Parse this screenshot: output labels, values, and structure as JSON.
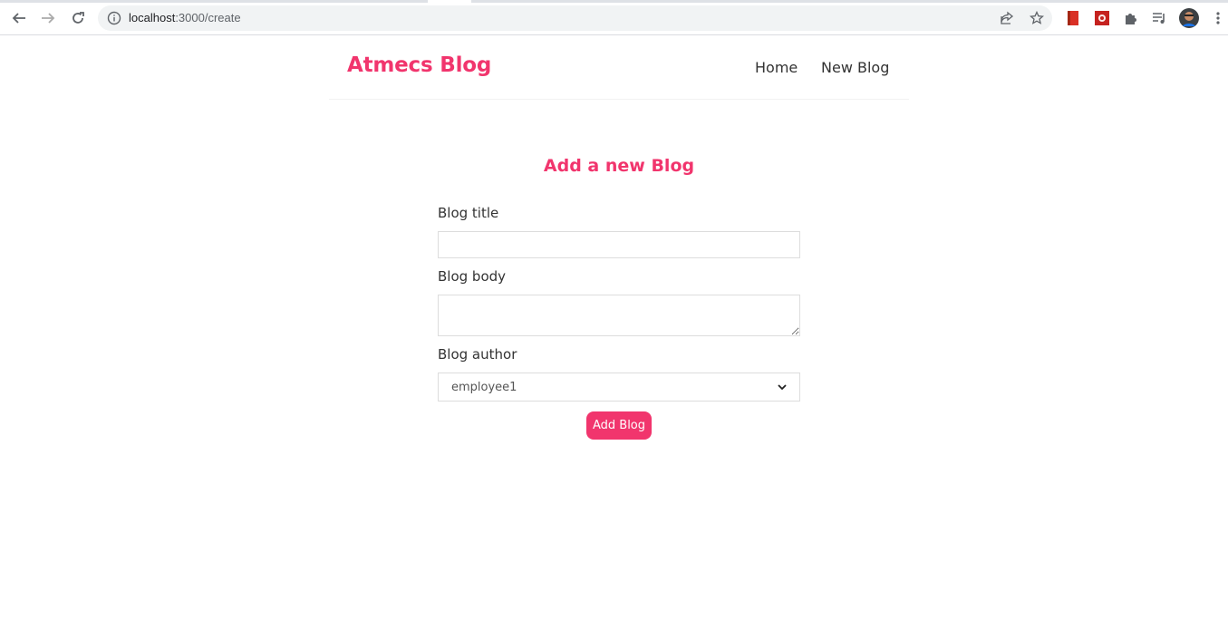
{
  "browser": {
    "url_host": "localhost",
    "url_rest": ":3000/create"
  },
  "navbar": {
    "brand": "Atmecs Blog",
    "links": [
      "Home",
      "New Blog"
    ]
  },
  "create": {
    "heading": "Add a new Blog",
    "title_label": "Blog title",
    "title_value": "",
    "body_label": "Blog body",
    "body_value": "",
    "author_label": "Blog author",
    "author_selected": "employee1",
    "submit_label": "Add Blog"
  },
  "colors": {
    "accent": "#f1356d"
  }
}
